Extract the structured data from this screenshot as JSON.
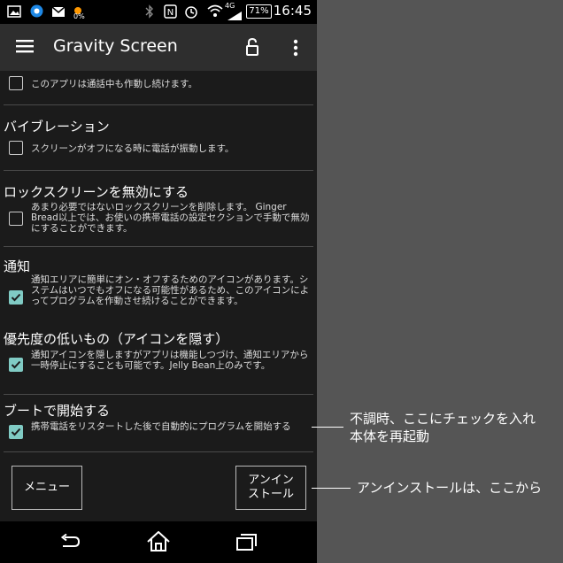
{
  "status_bar": {
    "battery": "71%",
    "time": "16:45",
    "network": "4G",
    "notification_badge": "0%"
  },
  "app_bar": {
    "title": "Gravity Screen"
  },
  "settings": [
    {
      "title": "",
      "description": "このアプリは通話中も作動し続けます。",
      "checked": false
    },
    {
      "title": "バイブレーション",
      "description": "スクリーンがオフになる時に電話が振動します。",
      "checked": false
    },
    {
      "title": "ロックスクリーンを無効にする",
      "description": "あまり必要ではないロックスクリーンを削除します。 Ginger Bread以上では、お使いの携帯電話の設定セクションで手動で無効にすることができます。",
      "checked": false
    },
    {
      "title": "通知",
      "description": "通知エリアに簡単にオン・オフするためのアイコンがあります。システムはいつでもオフになる可能性があるため、このアイコンによってプログラムを作動させ続けることができます。",
      "checked": true
    },
    {
      "title": "優先度の低いもの（アイコンを隠す）",
      "description": "通知アイコンを隠しますがアプリは機能しつづけ、通知エリアから一時停止にすることも可能です。Jelly Bean上のみです。",
      "checked": true
    },
    {
      "title": "ブートで開始する",
      "description": "携帯電話をリスタートした後で自動的にプログラムを開始する",
      "checked": true
    }
  ],
  "buttons": {
    "menu": "メニュー",
    "uninstall_line1": "アンイン",
    "uninstall_line2": "ストール"
  },
  "annotations": {
    "boot_line1": "不調時、ここにチェックを入れ",
    "boot_line2": "本体を再起動",
    "uninstall": "アンインストールは、ここから"
  },
  "colors": {
    "checkbox_accent": "#80cbc4",
    "background": "#1b1b1b",
    "app_bar": "#2e2e2e"
  }
}
